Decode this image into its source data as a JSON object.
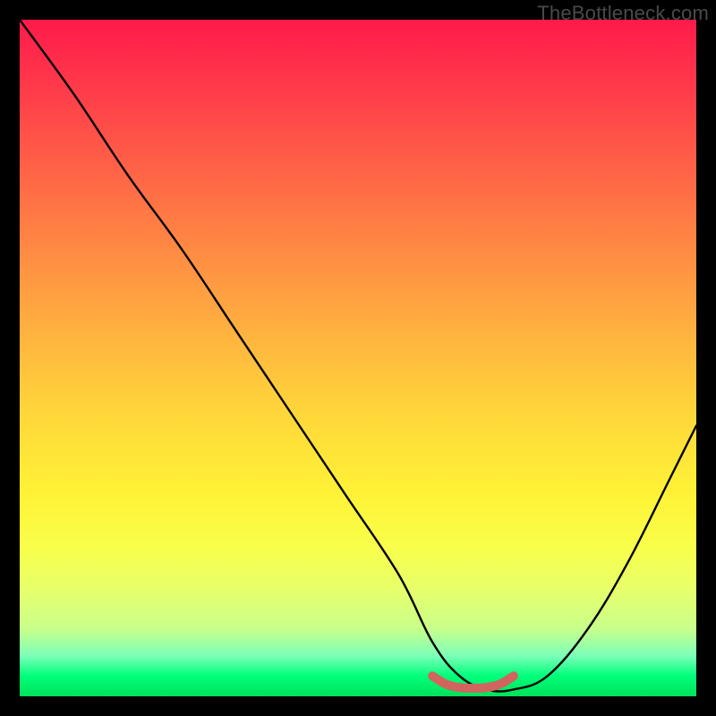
{
  "watermark": "TheBottleneck.com",
  "chart_data": {
    "type": "line",
    "title": "",
    "xlabel": "",
    "ylabel": "",
    "xlim": [
      0,
      100
    ],
    "ylim": [
      0,
      100
    ],
    "series": [
      {
        "name": "bottleneck-curve",
        "x": [
          0,
          8,
          16,
          24,
          32,
          40,
          48,
          56,
          61,
          65,
          69,
          73,
          78,
          84,
          90,
          96,
          100
        ],
        "values": [
          100,
          89,
          77,
          66,
          54,
          42,
          30,
          18,
          8,
          3,
          1,
          1,
          3,
          10,
          20,
          32,
          40
        ]
      },
      {
        "name": "optimal-band",
        "x": [
          61,
          63,
          65,
          67,
          69,
          71,
          73
        ],
        "values": [
          3,
          1.8,
          1.3,
          1.2,
          1.3,
          1.8,
          3
        ]
      }
    ],
    "annotations": [],
    "background": "red-yellow-green vertical gradient",
    "note": "x and y are normalized 0-100; y=0 is at the bottom of the plot area"
  }
}
